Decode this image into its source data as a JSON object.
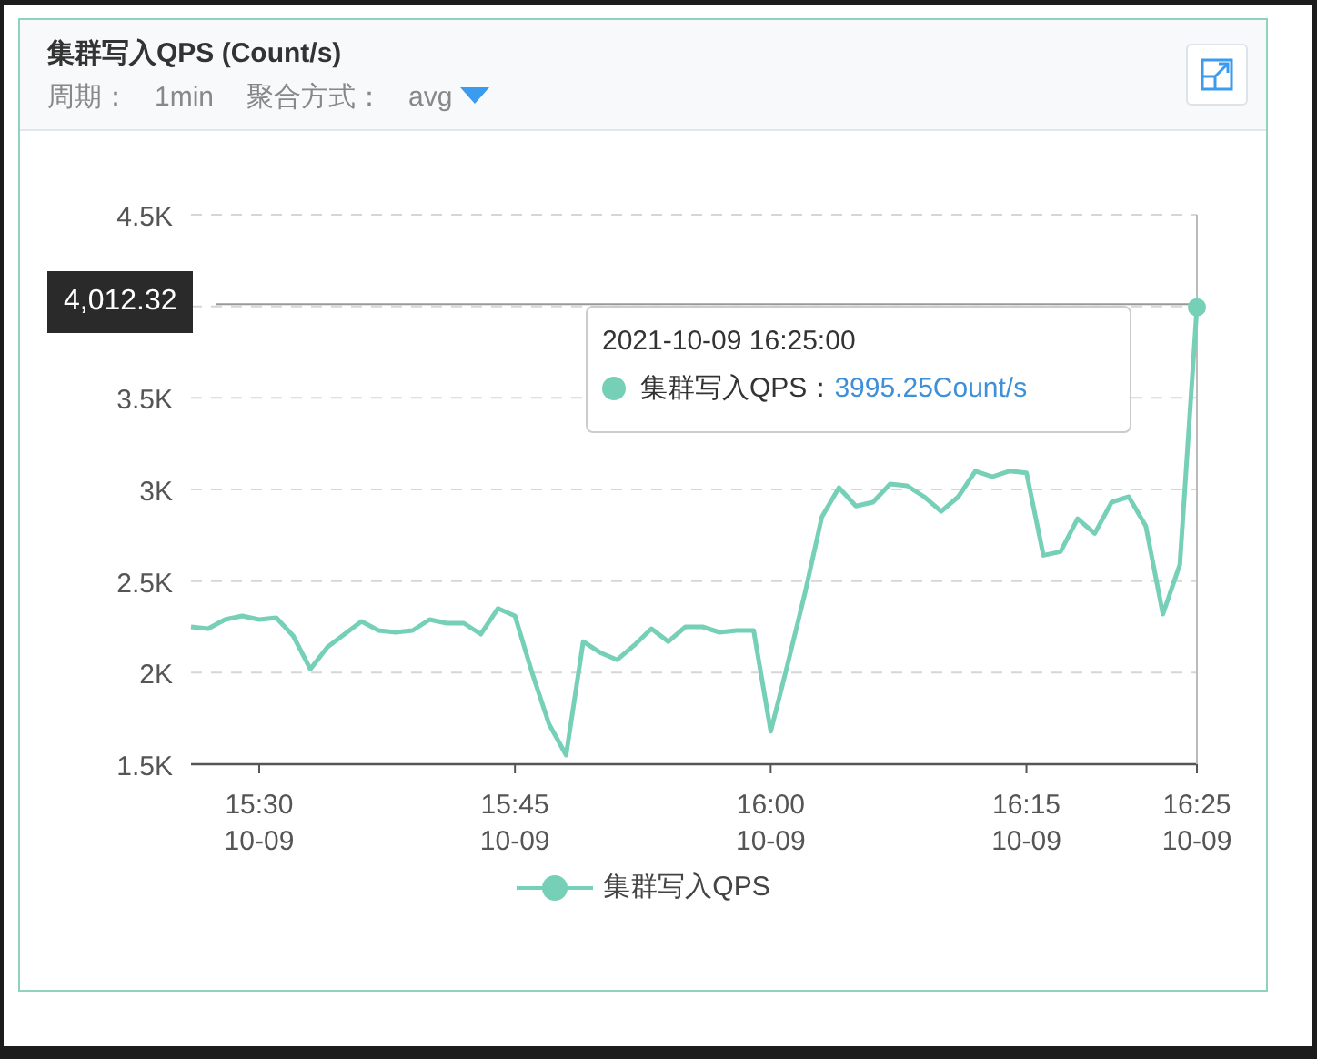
{
  "card": {
    "title": "集群写入QPS (Count/s)",
    "period_label": "周期：",
    "period_value": "1min",
    "aggregation_label": "聚合方式：",
    "aggregation_value": "avg"
  },
  "chart": {
    "chart_data": {
      "type": "line",
      "categories": [
        null,
        null,
        null,
        null,
        "15:30\n10-09",
        null,
        null,
        null,
        null,
        null,
        null,
        null,
        null,
        null,
        null,
        null,
        null,
        null,
        null,
        "15:45\n10-09",
        null,
        null,
        null,
        null,
        null,
        null,
        null,
        null,
        null,
        null,
        null,
        null,
        null,
        null,
        "16:00\n10-09",
        null,
        null,
        null,
        null,
        null,
        null,
        null,
        null,
        null,
        null,
        null,
        null,
        null,
        null,
        "16:15\n10-09",
        null,
        null,
        null,
        null,
        null,
        null,
        null,
        null,
        null,
        "16:25\n10-09"
      ],
      "grid": true,
      "ref_lines": [
        {
          "axis": "y",
          "value": 4012.32,
          "label": "4,012.32"
        }
      ],
      "series": [
        {
          "name": "集群写入QPS",
          "color": "#76d0b8",
          "values": [
            2250,
            2240,
            2290,
            2310,
            2290,
            2300,
            2200,
            2020,
            2140,
            2210,
            2280,
            2230,
            2220,
            2230,
            2290,
            2270,
            2270,
            2210,
            2350,
            2310,
            2000,
            1720,
            1550,
            2170,
            2110,
            2070,
            2150,
            2240,
            2170,
            2250,
            2250,
            2220,
            2230,
            2230,
            1680,
            2050,
            2430,
            2850,
            3010,
            2910,
            2930,
            3030,
            3020,
            2960,
            2880,
            2960,
            3100,
            3070,
            3100,
            3090,
            2640,
            2660,
            2840,
            2760,
            2930,
            2960,
            2800,
            2320,
            2590,
            3995
          ]
        }
      ],
      "ylim": [
        1500,
        4500
      ],
      "yticks": [
        {
          "value": 1500,
          "label": "1.5K"
        },
        {
          "value": 2000,
          "label": "2K"
        },
        {
          "value": 2500,
          "label": "2.5K"
        },
        {
          "value": 3000,
          "label": "3K"
        },
        {
          "value": 3500,
          "label": "3.5K"
        },
        {
          "value": 4500,
          "label": "4.5K"
        }
      ]
    },
    "tooltip": {
      "time": "2021-10-09 16:25:00",
      "series_label": "集群写入QPS：",
      "value": "3995.25Count/s",
      "color": "#76d0b8"
    }
  }
}
